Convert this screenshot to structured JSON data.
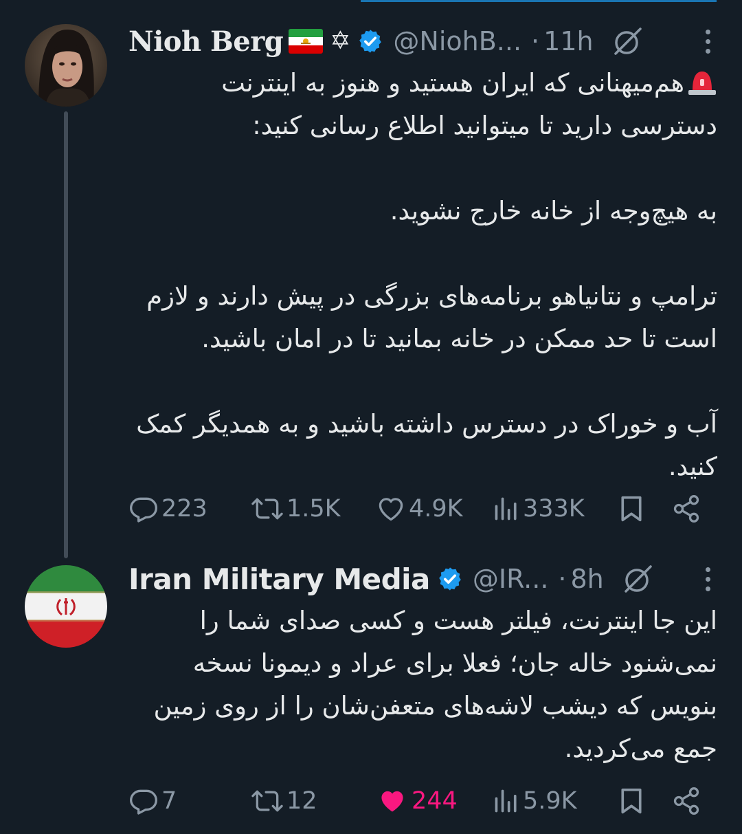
{
  "tweets": [
    {
      "display_name": "Nioh Berg",
      "handle": "@NiohB...",
      "dot": "·",
      "time": "11h",
      "flag_icon": "iran-lion-sun-flag-icon",
      "extra_icon": "star-of-david-icon",
      "extra_glyph": "✡",
      "verified": true,
      "body": {
        "line1": "هم‌میهنانی که ایران هستید و هنوز به اینترنت دسترسی دارید تا میتوانید اطلاع رسانی کنید:",
        "p2": "به هیچ‌وجه از خانه خارج نشوید.",
        "p3": "ترامپ و نتانیاهو برنامه‌های بزرگی در پیش دارند و لازم است تا حد ممکن در خانه بمانید تا در امان باشید.",
        "p4": "آب و خوراک در دسترس داشته باشید و به همدیگر کمک کنید."
      },
      "actions": {
        "replies": "223",
        "reposts": "1.5K",
        "likes": "4.9K",
        "views": "333K"
      },
      "liked": false
    },
    {
      "display_name": "Iran Military Media",
      "handle": "@IR...",
      "dot": "·",
      "time": "8h",
      "verified": true,
      "body": {
        "p1": "این جا اینترنت، فیلتر هست و کسی صدای شما را نمی‌شنود خاله جان؛ فعلا برای عراد و دیمونا نسخه بنویس که دیشب لاشه‌های متعفن‌شان را از روی زمین جمع می‌کردید."
      },
      "actions": {
        "replies": "7",
        "reposts": "12",
        "likes": "244",
        "views": "5.9K"
      },
      "liked": true
    }
  ],
  "colors": {
    "background": "#141d26",
    "text": "#e7e9ea",
    "muted": "#8b98a5",
    "verified": "#1d9bf0",
    "like_active": "#f91880"
  }
}
